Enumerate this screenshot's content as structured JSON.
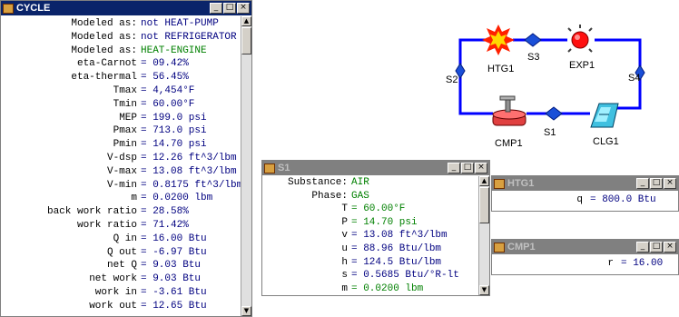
{
  "cycle_window": {
    "title": "CYCLE",
    "rows": [
      {
        "label": "Modeled as:",
        "value": "not HEAT-PUMP",
        "color": "#000080"
      },
      {
        "label": "Modeled as:",
        "value": "not REFRIGERATOR",
        "color": "#000080"
      },
      {
        "label": "Modeled as:",
        "value": "HEAT-ENGINE",
        "color": "#008000"
      },
      {
        "label": "eta-Carnot",
        "value": "= 09.42%",
        "color": "#000080"
      },
      {
        "label": "eta-thermal",
        "value": "= 56.45%",
        "color": "#000080"
      },
      {
        "label": "Tmax",
        "value": "= 4,454°F",
        "color": "#000080"
      },
      {
        "label": "Tmin",
        "value": "= 60.00°F",
        "color": "#000080"
      },
      {
        "label": "MEP",
        "value": "= 199.0 psi",
        "color": "#000080"
      },
      {
        "label": "Pmax",
        "value": "= 713.0 psi",
        "color": "#000080"
      },
      {
        "label": "Pmin",
        "value": "= 14.70 psi",
        "color": "#000080"
      },
      {
        "label": "V-dsp",
        "value": "= 12.26 ft^3/lbm",
        "color": "#000080"
      },
      {
        "label": "V-max",
        "value": "= 13.08 ft^3/lbm",
        "color": "#000080"
      },
      {
        "label": "V-min",
        "value": "= 0.8175 ft^3/lbm",
        "color": "#000080"
      },
      {
        "label": "m",
        "value": "= 0.0200 lbm",
        "color": "#000080"
      },
      {
        "label": "back work ratio",
        "value": "= 28.58%",
        "color": "#000080"
      },
      {
        "label": "work ratio",
        "value": "= 71.42%",
        "color": "#000080"
      },
      {
        "label": "Q in",
        "value": "= 16.00 Btu",
        "color": "#000080"
      },
      {
        "label": "Q out",
        "value": "= -6.97 Btu",
        "color": "#000080"
      },
      {
        "label": "net Q",
        "value": "= 9.03 Btu",
        "color": "#000080"
      },
      {
        "label": "net work",
        "value": "= 9.03 Btu",
        "color": "#000080"
      },
      {
        "label": "work in",
        "value": "= -3.61 Btu",
        "color": "#000080"
      },
      {
        "label": "work out",
        "value": "= 12.65 Btu",
        "color": "#000080"
      }
    ]
  },
  "diagram": {
    "devices": {
      "htg": "HTG1",
      "exp": "EXP1",
      "cmp": "CMP1",
      "clg": "CLG1"
    },
    "states": {
      "s1": "S1",
      "s2": "S2",
      "s3": "S3",
      "s4": "S4"
    },
    "line_color": "#0000ff"
  },
  "s1_window": {
    "title": "S1",
    "rows": [
      {
        "label": "Substance:",
        "value": "AIR",
        "color": "#008000"
      },
      {
        "label": "Phase:",
        "value": "GAS",
        "color": "#008000"
      },
      {
        "label": "T",
        "value": "= 60.00°F",
        "color": "#008000"
      },
      {
        "label": "P",
        "value": "= 14.70 psi",
        "color": "#008000"
      },
      {
        "label": "v",
        "value": "= 13.08 ft^3/lbm",
        "color": "#000080"
      },
      {
        "label": "u",
        "value": "= 88.96 Btu/lbm",
        "color": "#000080"
      },
      {
        "label": "h",
        "value": "= 124.5 Btu/lbm",
        "color": "#000080"
      },
      {
        "label": "s",
        "value": "= 0.5685 Btu/°R-lt",
        "color": "#000080"
      },
      {
        "label": "m",
        "value": "= 0.0200 lbm",
        "color": "#008000"
      }
    ]
  },
  "htg_window": {
    "title": "HTG1",
    "row": {
      "label": "q",
      "value": "= 800.0 Btu"
    }
  },
  "cmp_window": {
    "title": "CMP1",
    "row": {
      "label": "r",
      "value": "= 16.00"
    }
  },
  "buttons": {
    "minimize": "_",
    "maximize": "□",
    "close": "×",
    "up": "▲",
    "down": "▼"
  }
}
